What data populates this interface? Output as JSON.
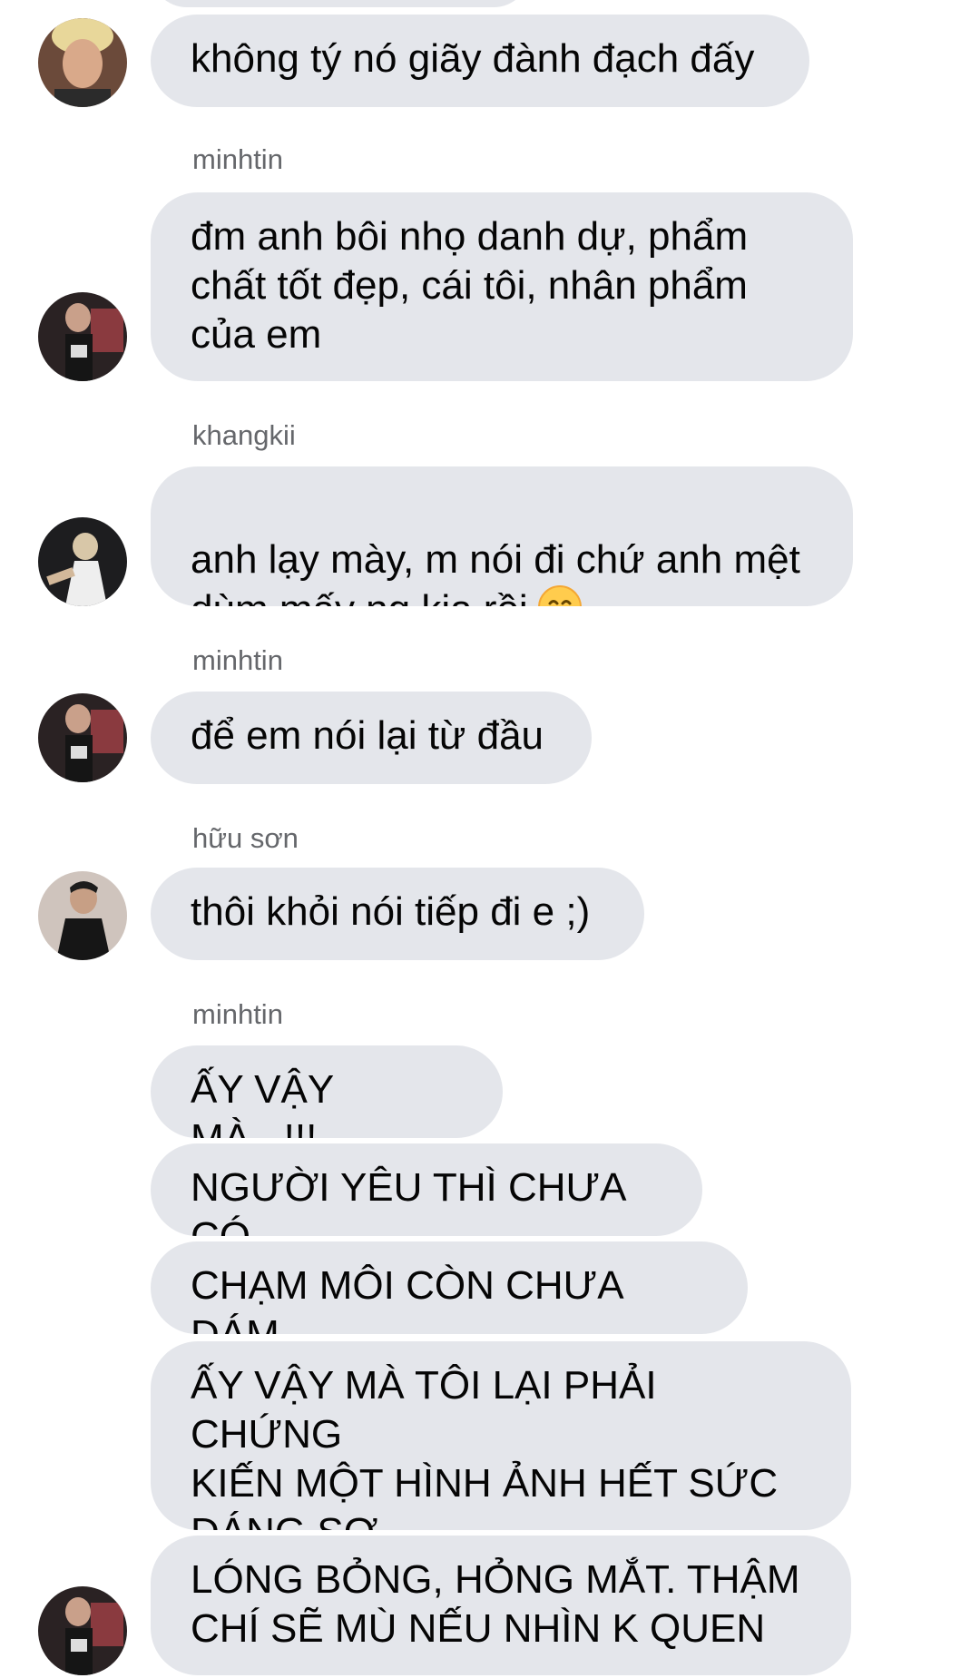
{
  "messages": [
    {
      "text": "không tý nó giãy đành đạch đấy"
    },
    {
      "sender": "minhtin",
      "text": "đm anh bôi nhọ danh dự, phẩm\nchất tốt đẹp, cái tôi, nhân phẩm\ncủa em"
    },
    {
      "sender": "khangkii",
      "text": "anh lạy mày, m nói đi chứ anh mệt\ndùm mấy ng kia rồi",
      "emoji": "smiling-face-emoji"
    },
    {
      "sender": "minhtin",
      "text": "để em nói lại từ đầu"
    },
    {
      "sender": "hữu sơn",
      "text": "thôi khỏi nói tiếp đi e ;)"
    },
    {
      "sender": "minhtin",
      "text": "ẤY VẬY MÀ...!!!"
    },
    {
      "text": "NGƯỜI YÊU THÌ CHƯA CÓ"
    },
    {
      "text": "CHẠM MÔI CÒN CHƯA DÁM"
    },
    {
      "text": "ẤY VẬY MÀ TÔI LẠI PHẢI CHỨNG\nKIẾN MỘT HÌNH ẢNH HẾT SỨC\nĐÁNG SỢ"
    },
    {
      "text": "LÓNG BỎNG, HỎNG MẮT. THẬM\nCHÍ SẼ MÙ NẾU NHÌN K QUEN"
    }
  ],
  "colors": {
    "bubble": "#e4e6eb",
    "text": "#050505",
    "sender_name": "#65676b",
    "background": "#ffffff"
  }
}
